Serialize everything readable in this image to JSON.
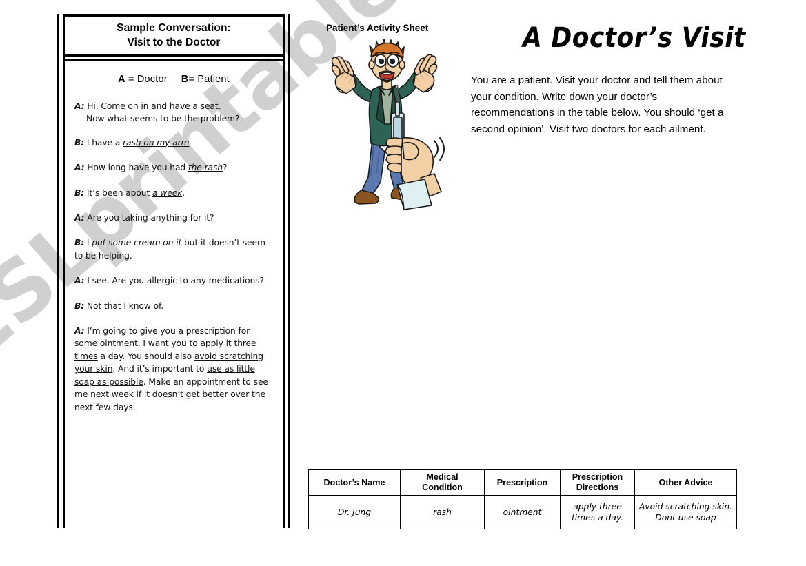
{
  "watermark": {
    "text": "ESLprintables.com"
  },
  "conversation_panel": {
    "title_line1": "Sample Conversation:",
    "title_line2": "Visit to the Doctor",
    "roles": {
      "a_key": "A",
      "a_value": " = Doctor",
      "b_key": "B",
      "b_value": "= Patient"
    },
    "turns": [
      {
        "speaker": "A:",
        "line1": "Hi. Come on in and have a seat.",
        "line2": "Now what seems to be the problem?"
      },
      {
        "speaker": "B:",
        "pre": " I have a ",
        "underlined": "rash on my arm",
        "post": ""
      },
      {
        "speaker": "A:",
        "pre": " How long have you had ",
        "underlined": "the rash",
        "post": "?"
      },
      {
        "speaker": "B:",
        "pre": "  It’s been about ",
        "underlined": "a week",
        "post": "."
      },
      {
        "speaker": "A:",
        "pre": "  Are you taking anything for it?",
        "underlined": "",
        "post": ""
      },
      {
        "speaker": "B:",
        "pre": " I ",
        "italic": "put some cream on it",
        "post": " but it doesn’t seem to be helping."
      },
      {
        "speaker": "A:",
        "pre": " I see. Are you allergic to any medications?",
        "post": ""
      },
      {
        "speaker": "B:",
        "pre": " Not that I know of.",
        "post": ""
      },
      {
        "speaker": "A:",
        "seg1": " I’m going to give you a prescription for ",
        "u1": "some ointment",
        "seg2": ". I want you to ",
        "u2": "apply it three times",
        "seg3": " a day. You should also ",
        "u3": "avoid scratching your skin",
        "seg4": ". And it’s important to ",
        "u4": "use as little soap as possible",
        "seg5": ". Make an appointment to see me next week if it doesn’t get better over the next few days."
      }
    ]
  },
  "activity": {
    "label": "Patient’s Activity Sheet",
    "title": "A Doctor’s Visit",
    "instructions": "You are a patient. Visit your doctor and tell them about your condition. Write down your doctor’s recommendations in the table below.  You should ‘get a second opinion’. Visit two doctors for each ailment."
  },
  "clipart": {
    "name": "scared-patient-with-syringe-illustration",
    "colors": {
      "jacket": "#2d6355",
      "jacket_shadow": "#21493f",
      "jeans": "#5b79ae",
      "jeans_shadow": "#46608f",
      "skin": "#f2cfa4",
      "skin_shadow": "#d8ac7c",
      "hair": "#d4772c",
      "shoe": "#8a5520",
      "syringe": "#dce9ef",
      "paper": "#dff0f2",
      "outline": "#1a1a1a"
    }
  },
  "table": {
    "headers": [
      "Doctor’s Name",
      "Medical\nCondition",
      "Prescription",
      "Prescription\nDirections",
      "Other Advice"
    ],
    "rows": [
      {
        "doctor_name": "Dr. Jung",
        "medical_condition": "rash",
        "prescription": "ointment",
        "prescription_directions": "apply three\ntimes a day.",
        "other_advice": "Avoid scratching skin.\nDont use soap"
      }
    ]
  }
}
